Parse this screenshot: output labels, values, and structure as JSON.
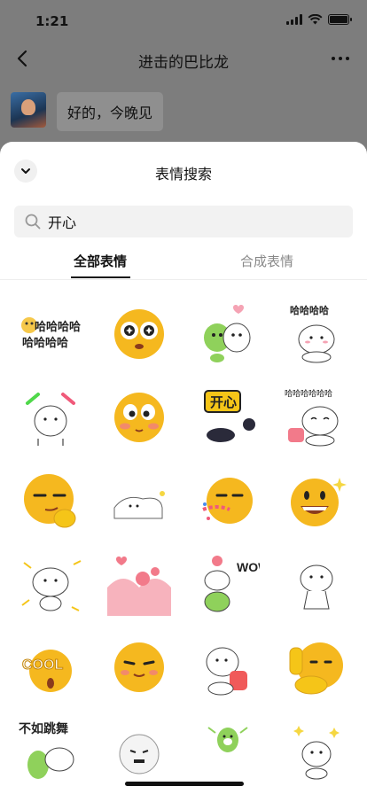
{
  "status_bar": {
    "time": "1:21"
  },
  "chat": {
    "title": "进击的巴比龙",
    "message": "好的，今晚见"
  },
  "sheet": {
    "title": "表情搜索",
    "search_value": "开心",
    "tabs": [
      {
        "label": "全部表情",
        "active": true
      },
      {
        "label": "合成表情",
        "active": false
      }
    ]
  },
  "stickers": [
    {
      "name": "haha-text-sticker",
      "text": "哈哈哈哈"
    },
    {
      "name": "starry-eyes-emoji-sticker"
    },
    {
      "name": "dogs-heart-sticker"
    },
    {
      "name": "dog-haha-sticker",
      "text": "哈哈哈哈"
    },
    {
      "name": "dog-glowsticks-sticker"
    },
    {
      "name": "blushing-emoji-sticker"
    },
    {
      "name": "kaixin-sign-sticker",
      "text": "开心"
    },
    {
      "name": "dog-laughing-haha-sticker",
      "text": "哈哈哈哈哈哈"
    },
    {
      "name": "smug-thumbs-emoji-sticker"
    },
    {
      "name": "lying-dog-sticker"
    },
    {
      "name": "party-horn-emoji-sticker"
    },
    {
      "name": "grin-sparkle-emoji-sticker"
    },
    {
      "name": "dancing-dog-sticker"
    },
    {
      "name": "hearts-cake-sticker"
    },
    {
      "name": "wow-dogs-sticker",
      "text": "WOW"
    },
    {
      "name": "waving-dog-sticker"
    },
    {
      "name": "cool-emoji-sticker",
      "text": "COOL"
    },
    {
      "name": "content-emoji-sticker"
    },
    {
      "name": "dog-red-bag-sticker"
    },
    {
      "name": "thumbs-up-emoji-sticker"
    },
    {
      "name": "dance-text-sticker",
      "text": "不如跳舞"
    },
    {
      "name": "white-dog-sticker"
    },
    {
      "name": "green-frog-sticker"
    },
    {
      "name": "sparkle-dog-sticker"
    }
  ]
}
